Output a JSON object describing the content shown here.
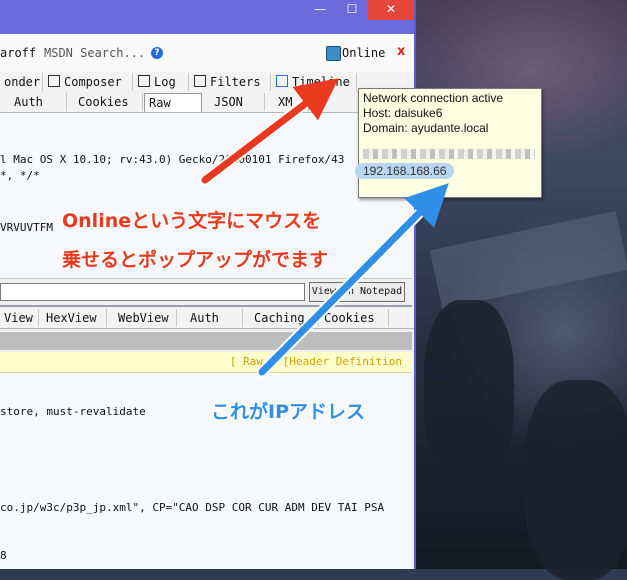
{
  "window": {
    "minimize_glyph": "—",
    "maximize_glyph": "☐",
    "close_glyph": "✕"
  },
  "toolbar": {
    "partial_label": "aroff",
    "search_placeholder": "MSDN Search...",
    "status_label": "Online",
    "status_close": "x",
    "icons": [
      "help-icon",
      "network-online-icon",
      "close-icon"
    ]
  },
  "main_tabs": [
    "onder",
    "Composer",
    "Log",
    "Filters",
    "Timeline"
  ],
  "request_tabs": [
    "Auth",
    "Cookies",
    "Raw",
    "JSON",
    "XM"
  ],
  "request_lines": [
    "l Mac OS X 10.10; rv:43.0) Gecko/20100101 Firefox/43",
    "*, */*",
    "VRVUVTFM"
  ],
  "notepad_button": "View in Notepad",
  "response_tabs": [
    "View",
    "HexView",
    "WebView",
    "Auth",
    "Caching",
    "Cookies"
  ],
  "header_definition": "[ Raw ]  [Header Definition",
  "response_lines": [
    "store, must-revalidate",
    "co.jp/w3c/p3p_jp.xml\", CP=\"CAO DSP COR CUR ADM DEV TAI PSA",
    "8"
  ],
  "popup": {
    "line1": "Network connection active",
    "line2": "Host: daisuke6",
    "line3": "Domain: ayudante.local",
    "ip": "192.168.168.66"
  },
  "annotations": {
    "red_line1": "Onlineという文字にマウスを",
    "red_line2": "乗せるとポップアップがでます",
    "blue": "これがIPアドレス",
    "colors": {
      "red": "#e8381d",
      "blue": "#2f8ee6"
    }
  }
}
